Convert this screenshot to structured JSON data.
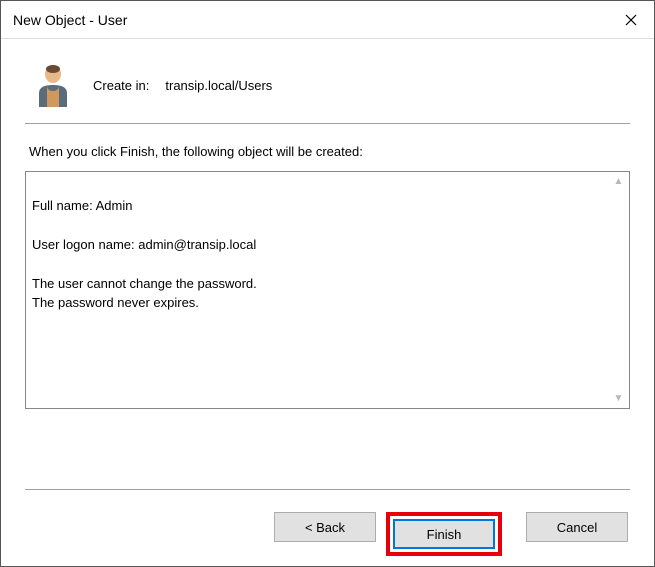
{
  "window": {
    "title": "New Object - User"
  },
  "header": {
    "create_in_label": "Create in:",
    "create_in_path": "transip.local/Users"
  },
  "instruction": "When you click Finish, the following object will be created:",
  "summary": {
    "full_name_label": "Full name:",
    "full_name_value": "Admin",
    "logon_label": "User logon name:",
    "logon_value": "admin@transip.local",
    "note_cannot_change": "The user cannot change the password.",
    "note_never_expires": "The password never expires."
  },
  "buttons": {
    "back": "< Back",
    "finish": "Finish",
    "cancel": "Cancel"
  }
}
